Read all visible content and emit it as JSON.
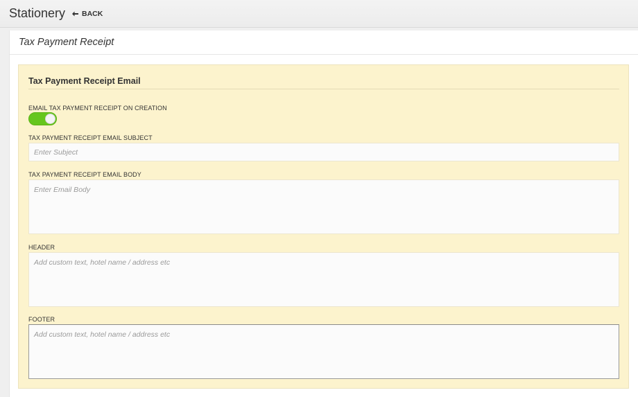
{
  "topbar": {
    "title": "Stationery",
    "back_label": "BACK"
  },
  "panel": {
    "title": "Tax Payment Receipt"
  },
  "card": {
    "title": "Tax Payment Receipt Email",
    "toggle": {
      "label": "EMAIL TAX PAYMENT RECEIPT ON CREATION",
      "on": true,
      "color": "#66c61e"
    },
    "subject": {
      "label": "TAX PAYMENT RECEIPT EMAIL SUBJECT",
      "placeholder": "Enter Subject",
      "value": ""
    },
    "body": {
      "label": "TAX PAYMENT RECEIPT EMAIL BODY",
      "placeholder": "Enter Email Body",
      "value": ""
    },
    "header": {
      "label": "HEADER",
      "placeholder": "Add custom text, hotel name / address etc",
      "value": ""
    },
    "footer": {
      "label": "FOOTER",
      "placeholder": "Add custom text, hotel name / address etc",
      "value": ""
    }
  }
}
